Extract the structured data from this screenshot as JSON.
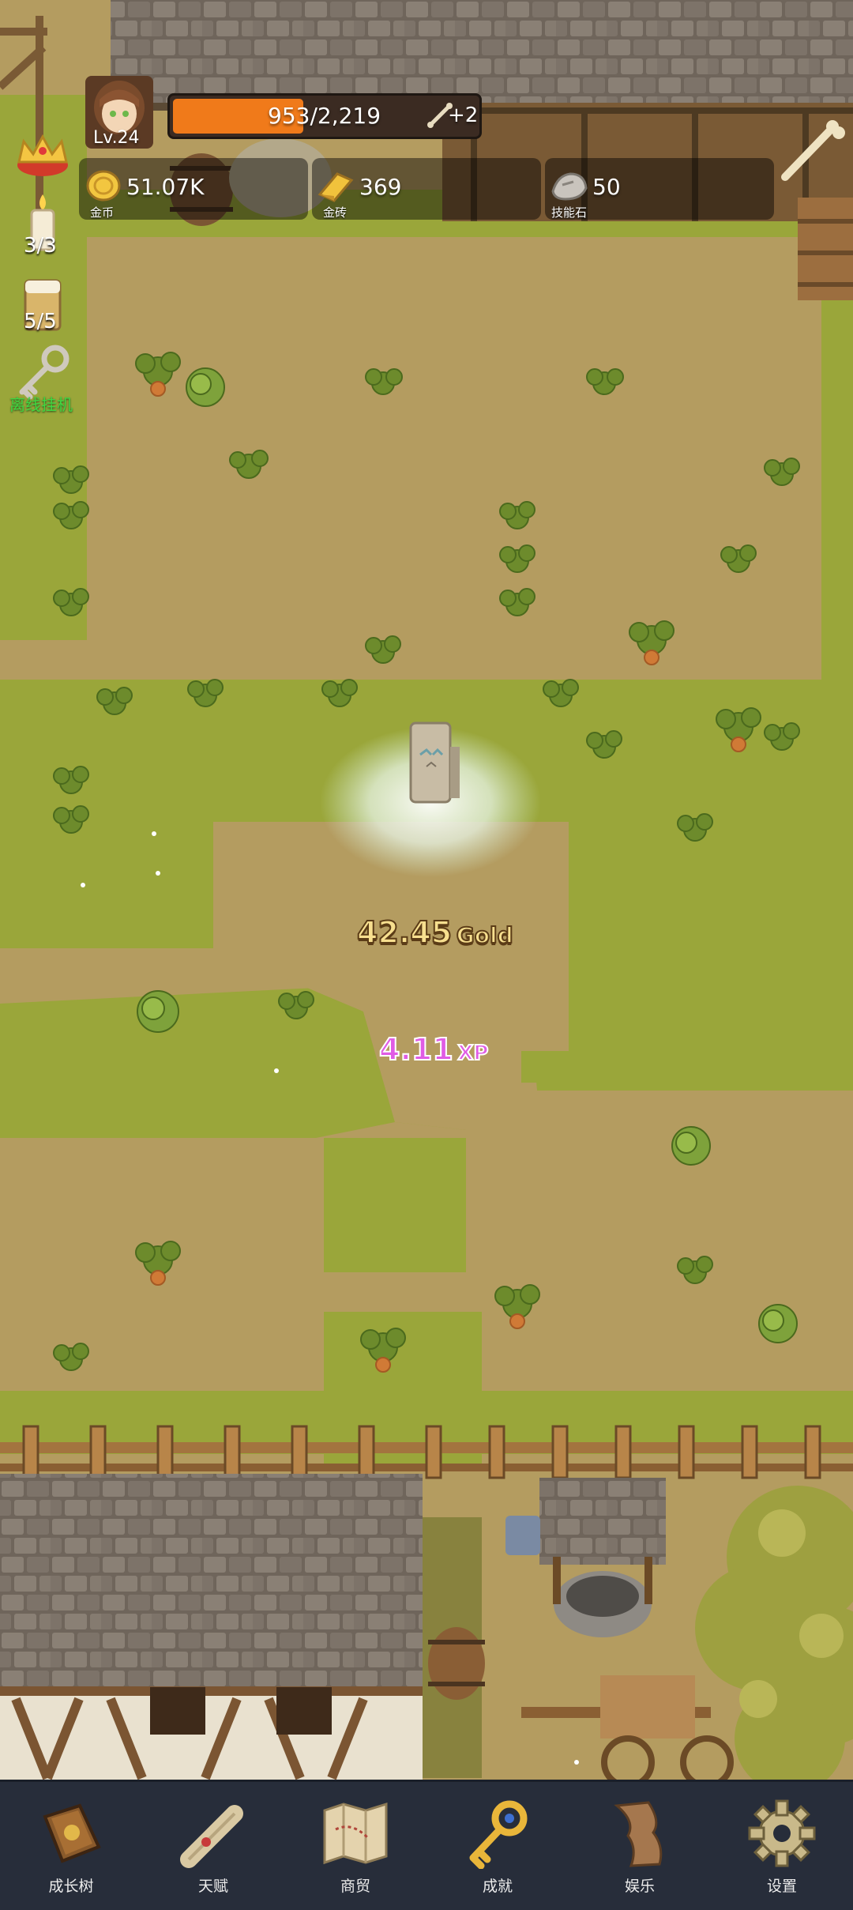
{
  "player": {
    "level": "Lv.24",
    "hp_text": "953/2,219",
    "hp_fraction": 0.43,
    "bonus": "+2"
  },
  "resources": [
    {
      "name": "金币",
      "value": "51.07K",
      "icon": "gold-coin-icon"
    },
    {
      "name": "金砖",
      "value": "369",
      "icon": "gold-bar-icon"
    },
    {
      "name": "技能石",
      "value": "50",
      "icon": "skill-stone-icon"
    }
  ],
  "side_items": {
    "candle_count": "3/3",
    "beer_count": "5/5",
    "idle_label": "离线挂机"
  },
  "floaters": {
    "gold_value": "42.45",
    "gold_unit": "Gold",
    "xp_value": "4.11",
    "xp_unit": "XP"
  },
  "nav": [
    {
      "label": "成长树",
      "icon": "growth-book-icon"
    },
    {
      "label": "天赋",
      "icon": "talent-scroll-icon"
    },
    {
      "label": "商贸",
      "icon": "trade-map-icon"
    },
    {
      "label": "成就",
      "icon": "achievement-key-icon"
    },
    {
      "label": "娱乐",
      "icon": "entertainment-scroll-icon"
    },
    {
      "label": "设置",
      "icon": "settings-gear-icon"
    }
  ],
  "colors": {
    "hp_bar": "#f07a1a",
    "gold_text": "#f7df8f",
    "xp_text": "#e05ce5",
    "idle_text": "#42d642",
    "nav_bg": "#272d3a"
  }
}
